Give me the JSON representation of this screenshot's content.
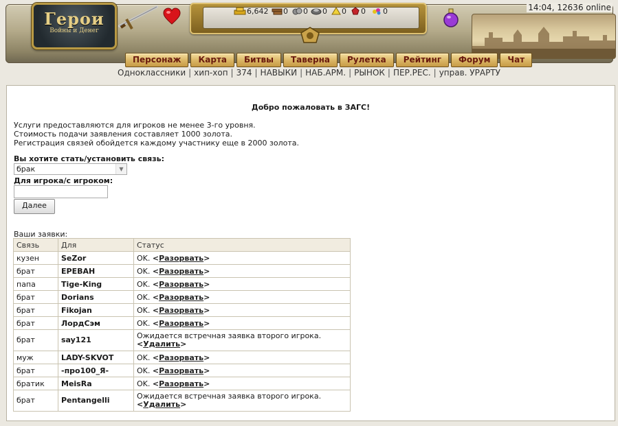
{
  "header": {
    "logo_title": "Герои",
    "logo_subtitle": "Войны и Денег",
    "clock": "14:04, 12636 online",
    "resources": [
      {
        "icon": "gold-icon",
        "value": "6,642"
      },
      {
        "icon": "wood-icon",
        "value": "0"
      },
      {
        "icon": "ore-icon",
        "value": "0"
      },
      {
        "icon": "mercury-icon",
        "value": "0"
      },
      {
        "icon": "sulfur-icon",
        "value": "0"
      },
      {
        "icon": "crystal-icon",
        "value": "0"
      },
      {
        "icon": "gems-icon",
        "value": "0"
      }
    ]
  },
  "nav": {
    "items": [
      "Персонаж",
      "Карта",
      "Битвы",
      "Таверна",
      "Рулетка",
      "Рейтинг",
      "Форум",
      "Чат"
    ]
  },
  "sublinks": [
    "Одноклассники",
    "хип-хоп",
    "374",
    "НАВЫКИ",
    "НАБ.АРМ.",
    "РЫНОК",
    "ПЕР.РЕС.",
    "управ. УРАРТУ"
  ],
  "page": {
    "welcome": "Добро пожаловать в ЗАГС!",
    "info_line1": "Услуги предоставляются для игроков не менее 3-го уровня.",
    "info_line2": "Стоимость подачи заявления составляет 1000 золота.",
    "info_line3": "Регистрация связей обойдется каждому участнику еще в 2000 золота.",
    "relation_label": "Вы хотите стать/установить связь:",
    "relation_selected": "брак",
    "player_label": "Для игрока/с игроком:",
    "player_value": "",
    "submit_label": "Далее",
    "applications_title": "Ваши заявки:"
  },
  "table": {
    "headers": [
      "Связь",
      "Для",
      "Статус"
    ],
    "rows": [
      {
        "rel": "кузен",
        "player": "SeZor",
        "status": "OK.",
        "action": "Разорвать"
      },
      {
        "rel": "брат",
        "player": "ЕРЕВАН",
        "status": "OK.",
        "action": "Разорвать"
      },
      {
        "rel": "папа",
        "player": "Tige-King",
        "status": "OK.",
        "action": "Разорвать"
      },
      {
        "rel": "брат",
        "player": "Dorians",
        "status": "OK.",
        "action": "Разорвать"
      },
      {
        "rel": "брат",
        "player": "Fikojan",
        "status": "OK.",
        "action": "Разорвать"
      },
      {
        "rel": "брат",
        "player": "ЛордСэм",
        "status": "OK.",
        "action": "Разорвать"
      },
      {
        "rel": "брат",
        "player": "say121",
        "status": "Ожидается встречная заявка второго игрока.",
        "action": "Удалить"
      },
      {
        "rel": "муж",
        "player": "LADY-SKVOT",
        "status": "OK.",
        "action": "Разорвать"
      },
      {
        "rel": "брат",
        "player": "-про100_Я-",
        "status": "OK.",
        "action": "Разорвать"
      },
      {
        "rel": "братик",
        "player": "MeisRa",
        "status": "OK.",
        "action": "Разорвать"
      },
      {
        "rel": "брат",
        "player": "Pentangelli",
        "status": "Ожидается встречная заявка второго игрока.",
        "action": "Удалить"
      }
    ]
  }
}
